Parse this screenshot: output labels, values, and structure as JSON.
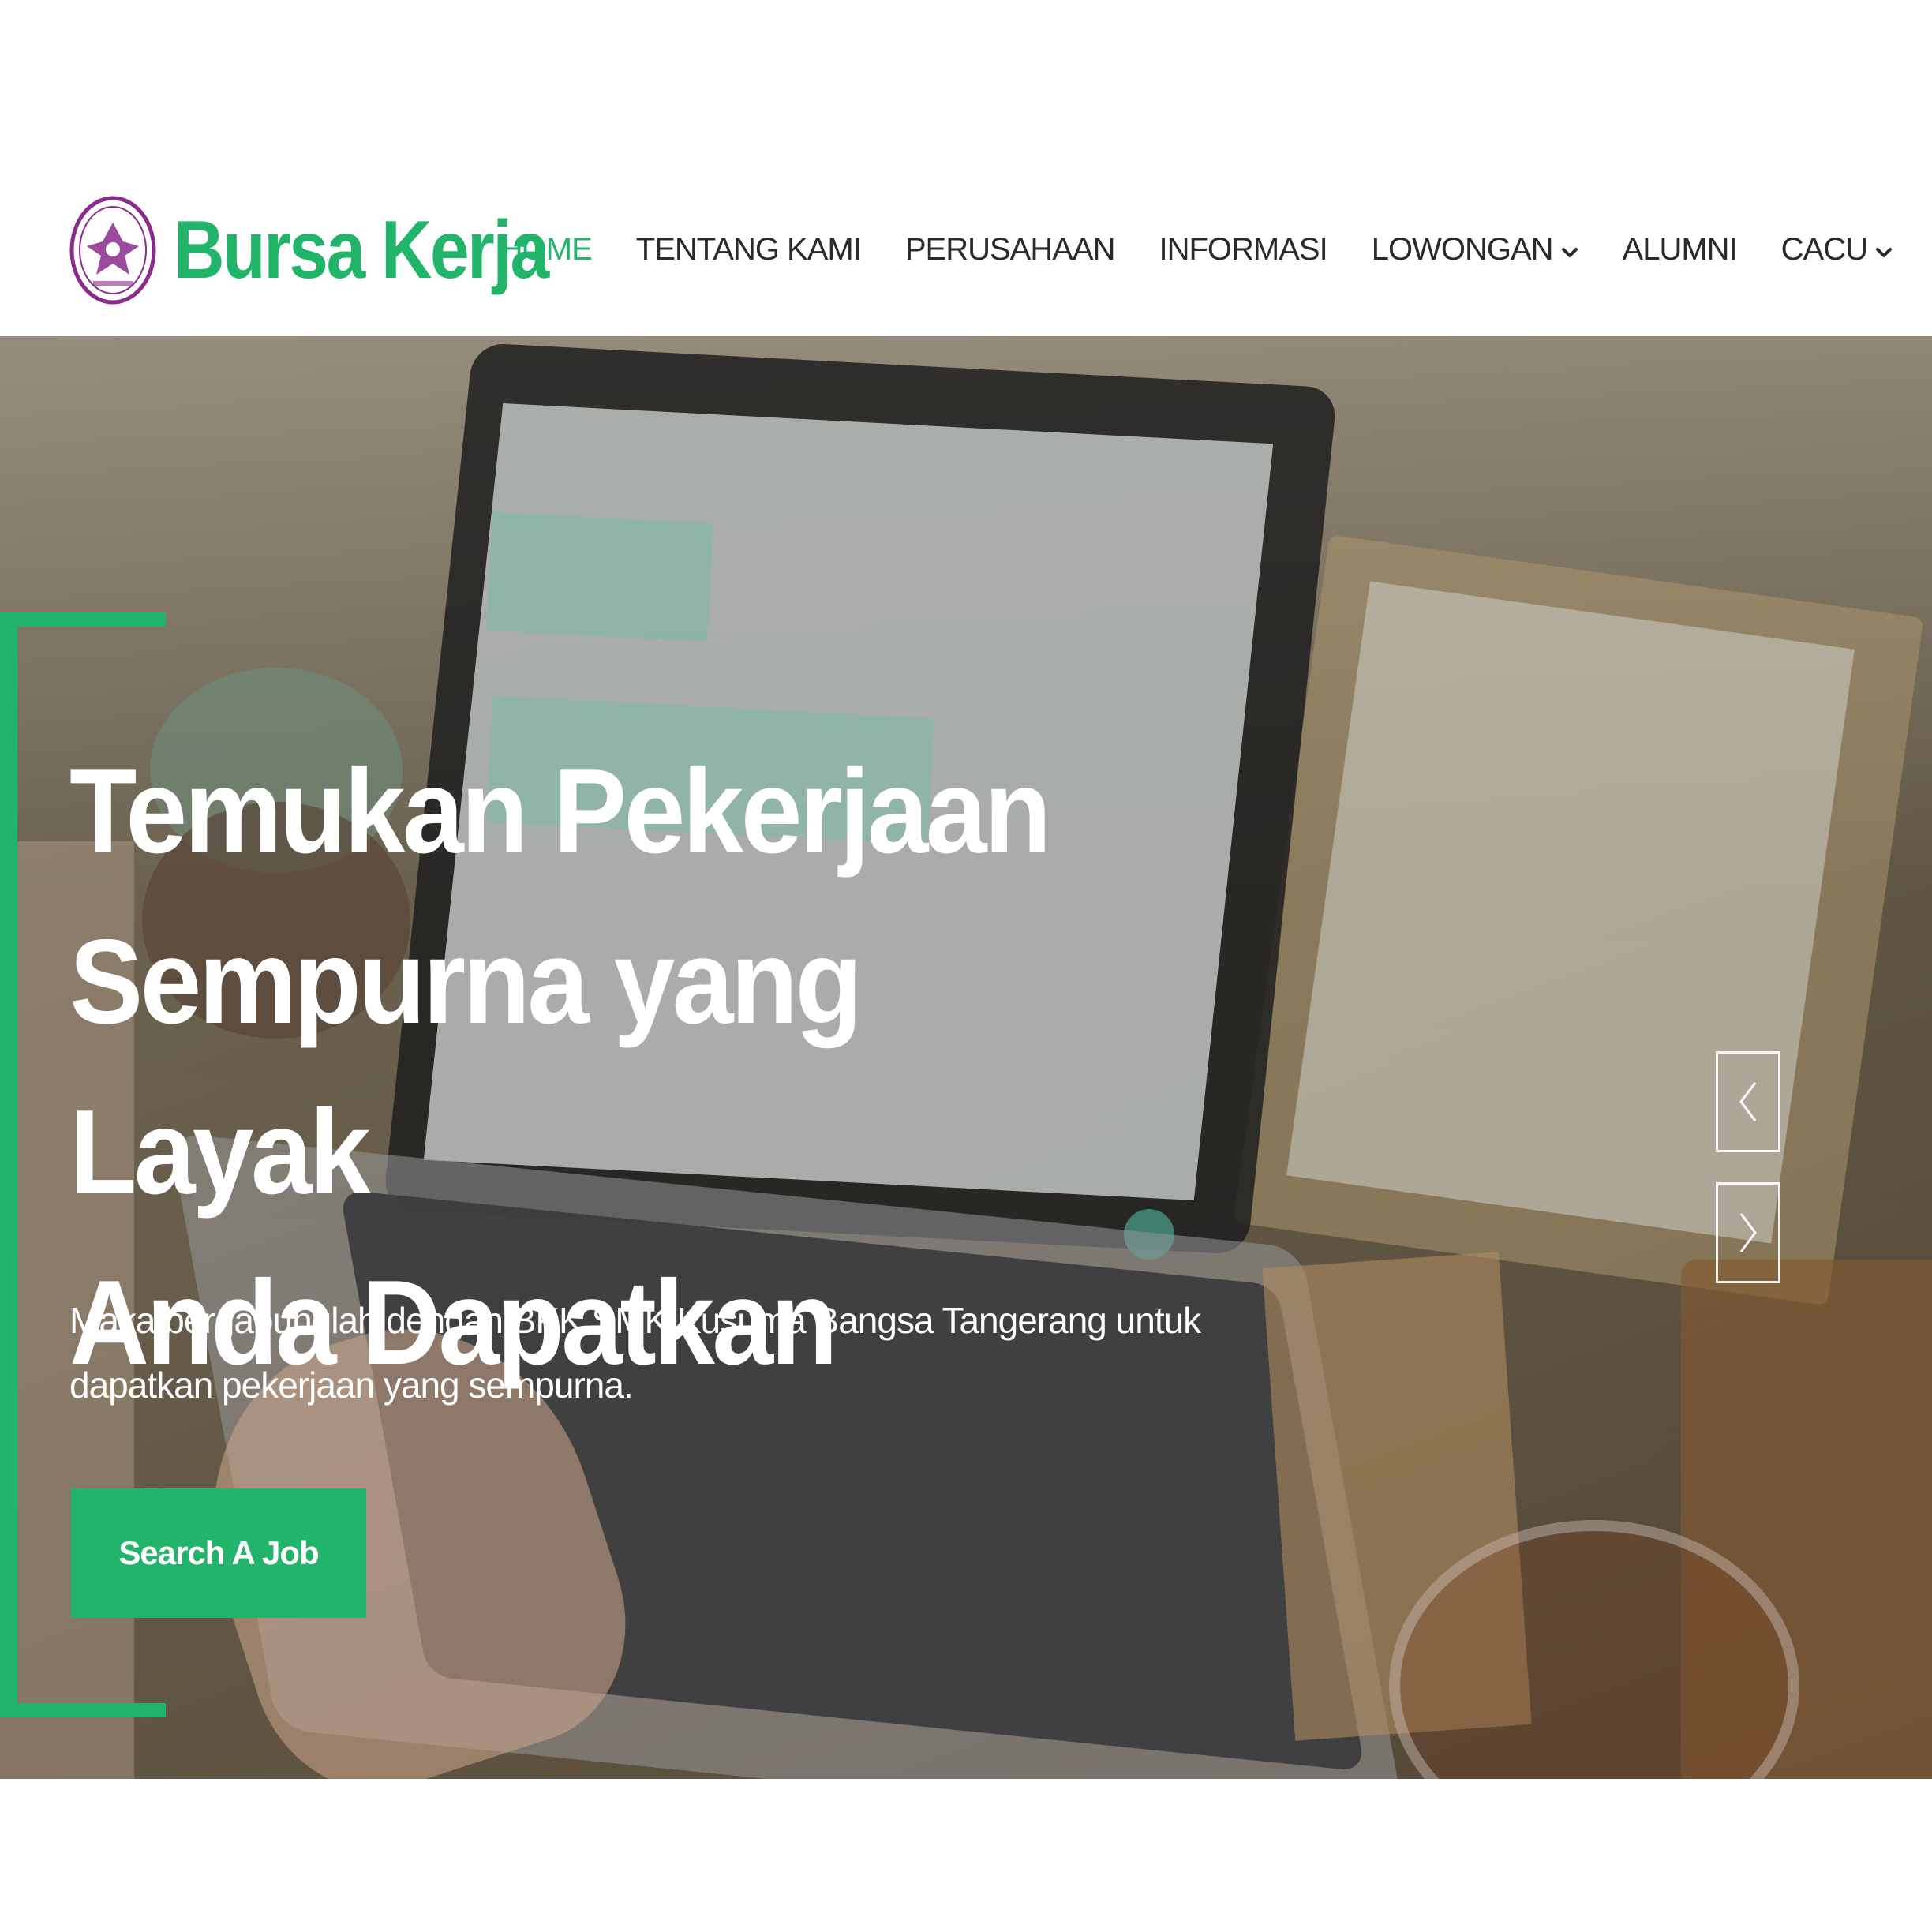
{
  "brand": {
    "name": "Bursa Kerja",
    "logo_icon": "school-emblem-icon"
  },
  "nav": {
    "items": [
      {
        "label": "HOME",
        "active": true
      },
      {
        "label": "TENTANG KAMI"
      },
      {
        "label": "PERUSAHAAN"
      },
      {
        "label": "INFORMASI"
      },
      {
        "label": "LOWONGAN",
        "dropdown": true
      },
      {
        "label": "ALUMNI"
      },
      {
        "label": "CACU",
        "dropdown": true
      }
    ]
  },
  "hero": {
    "title": "Temukan Pekerjaan\nSempurna yang Layak\nAnda Dapatkan",
    "subtitle": "Maka bergabunglah dengan BKK SMK Kusuma Bangsa Tangerang untuk dapatkan pekerjaan yang sempurna.",
    "cta_label": "Search A Job",
    "prev_icon": "chevron-left-icon",
    "next_icon": "chevron-right-icon"
  },
  "colors": {
    "accent": "#22b46b",
    "nav_text": "#2a2a2a",
    "logo_purple": "#8a2a8c"
  }
}
